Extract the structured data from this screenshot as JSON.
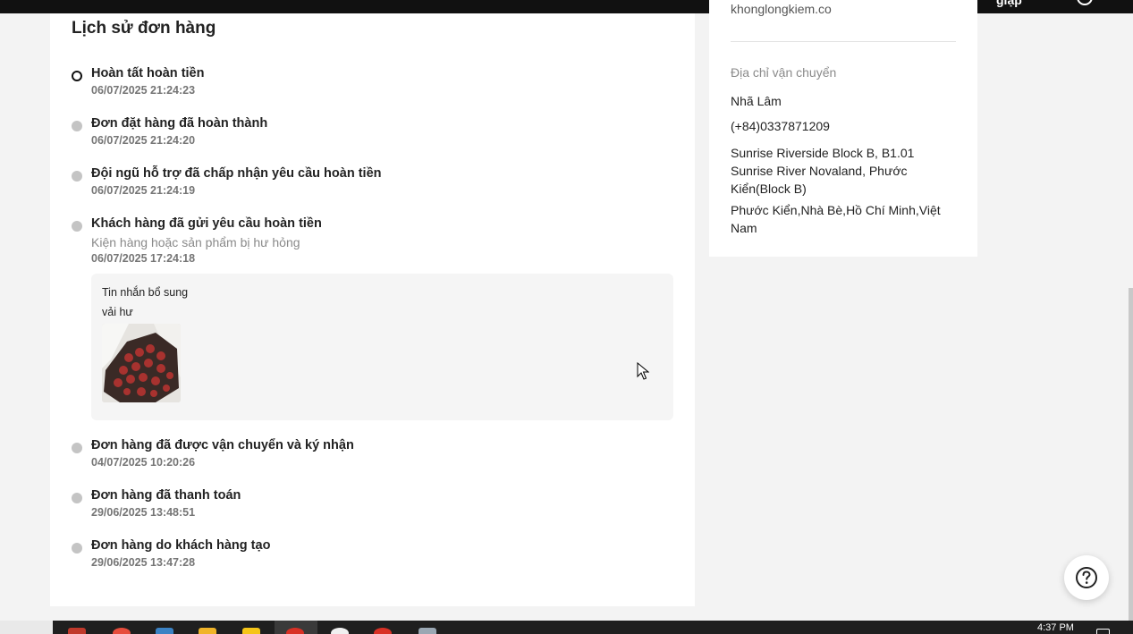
{
  "topbar": {
    "login_label": "giập"
  },
  "history": {
    "title": "Lịch sử đơn hàng",
    "events": [
      {
        "title": "Hoàn tất hoàn tiền",
        "time": "06/07/2025 21:24:23"
      },
      {
        "title": "Đơn đặt hàng đã hoàn thành",
        "time": "06/07/2025 21:24:20"
      },
      {
        "title": "Đội ngũ hỗ trợ đã chấp nhận yêu cầu hoàn tiền",
        "time": "06/07/2025 21:24:19"
      },
      {
        "title": "Khách hàng đã gửi yêu cầu hoàn tiền",
        "reason": "Kiện hàng hoặc sản phẩm bị hư hỏng",
        "time": "06/07/2025 17:24:18"
      },
      {
        "title": "Đơn hàng đã được vận chuyển và ký nhận",
        "time": "04/07/2025 10:20:26"
      },
      {
        "title": "Đơn hàng đã thanh toán",
        "time": "29/06/2025 13:48:51"
      },
      {
        "title": "Đơn hàng do khách hàng tạo",
        "time": "29/06/2025 13:47:28"
      }
    ],
    "extra": {
      "label": "Tin nhắn bổ sung",
      "message": "vải hư"
    }
  },
  "address": {
    "email_partial": "khonglongkiem.co",
    "heading": "Địa chỉ vận chuyển",
    "name": "Nhã Lâm",
    "phone": "(+84)0337871209",
    "line1": "Sunrise Riverside Block B, B1.01 Sunrise River Novaland, Phước Kiển(Block B)",
    "line2": "Phước Kiển,Nhà Bè,Hồ Chí Minh,Việt Nam"
  },
  "taskbar": {
    "clock": "4:37 PM"
  },
  "colors": {
    "page_bg": "#f3f3f3",
    "card_bg": "#ffffff",
    "timeline_dot": "#c4c4c4",
    "active_dot_border": "#111111",
    "muted_text": "#757575"
  }
}
